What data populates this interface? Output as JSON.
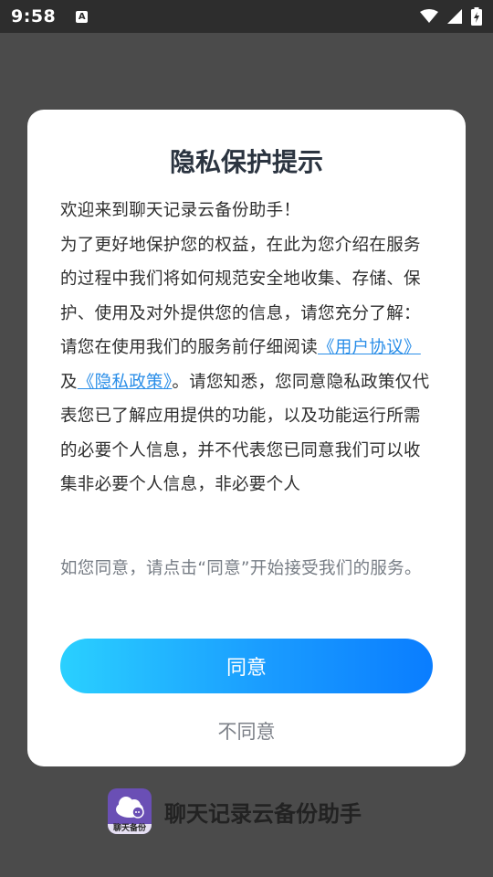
{
  "status_bar": {
    "time": "9:58",
    "notification_icon_letter": "A",
    "icons": [
      "wifi-icon",
      "signal-icon",
      "battery-icon"
    ]
  },
  "dialog": {
    "title": "隐私保护提示",
    "paragraphs": {
      "welcome": "欢迎来到聊天记录云备份助手！",
      "intro": "为了更好地保护您的权益，在此为您介绍在服务的过程中我们将如何规范安全地收集、存储、保护、使用及对外提供您的信息，请您充分了解：",
      "read_prefix": "请您在使用我们的服务前仔细阅读",
      "user_agreement_link": "《用户协议》",
      "and": "及",
      "privacy_policy_link": "《隐私政策》",
      "read_suffix": "。请您知悉，您同意隐私政策仅代表您已了解应用提供的功能，以及功能运行所需的必要个人信息，并不代表您已同意我们可以收集非必要个人信息，非必要个人"
    },
    "footer_note": "如您同意，请点击“同意”开始接受我们的服务。",
    "agree_label": "同意",
    "disagree_label": "不同意"
  },
  "background_app": {
    "logo_caption": "聊天备份",
    "name": "聊天记录云备份助手"
  },
  "colors": {
    "link": "#2a8ee8",
    "button_gradient_start": "#2ad0ff",
    "button_gradient_end": "#0a7dff",
    "overlay": "#4b4b4b"
  }
}
